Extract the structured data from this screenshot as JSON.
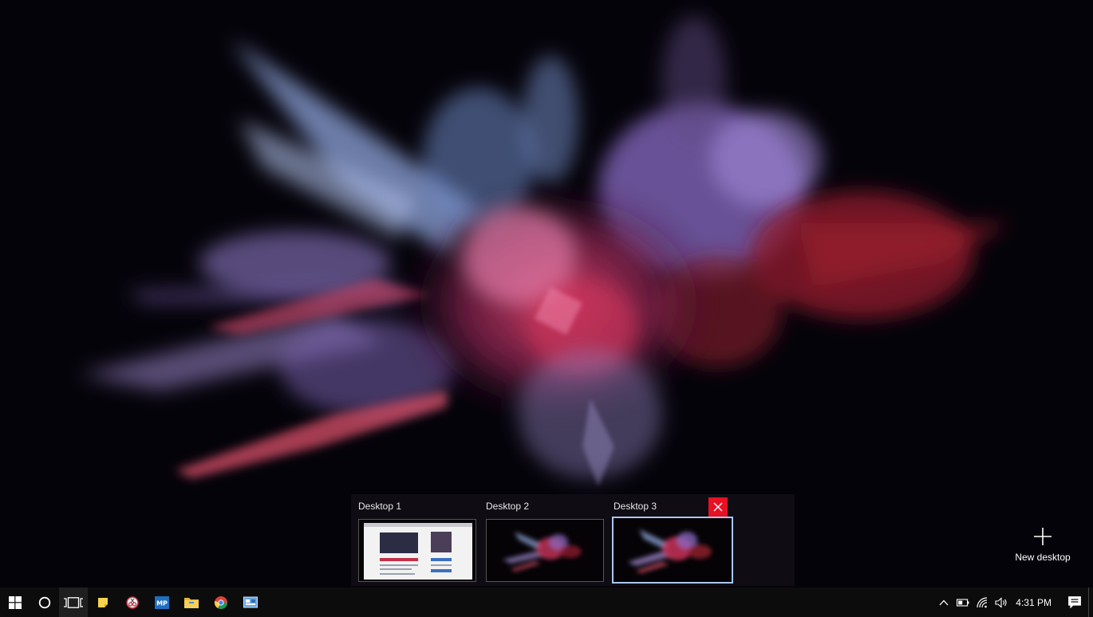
{
  "task_view": {
    "desktops": [
      {
        "label": "Desktop 1",
        "active": false
      },
      {
        "label": "Desktop 2",
        "active": false
      },
      {
        "label": "Desktop 3",
        "active": true
      }
    ],
    "new_desktop_label": "New desktop"
  },
  "taskbar": {
    "pinned": [
      {
        "name": "start",
        "icon": "windows-logo-icon"
      },
      {
        "name": "cortana",
        "icon": "cortana-circle-icon"
      },
      {
        "name": "task-view",
        "icon": "task-view-icon"
      },
      {
        "name": "sticky-notes",
        "icon": "sticky-notes-icon"
      },
      {
        "name": "snipping",
        "icon": "snipping-tool-icon"
      },
      {
        "name": "mp-app",
        "icon": "mp-app-icon",
        "text": "MP"
      },
      {
        "name": "file-explorer",
        "icon": "folder-icon"
      },
      {
        "name": "chrome",
        "icon": "chrome-icon"
      },
      {
        "name": "control-panel",
        "icon": "control-panel-icon"
      }
    ],
    "clock": "4:31 PM"
  },
  "colors": {
    "close": "#e81123",
    "active_border": "#a9c7ee",
    "taskbar": "#0c0c0c"
  }
}
